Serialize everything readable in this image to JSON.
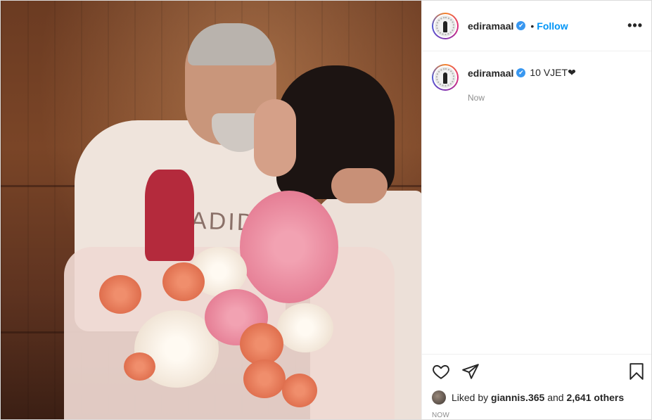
{
  "post": {
    "username": "ediramaal",
    "verified_badge": "✔",
    "separator": "•",
    "follow_label": "Follow",
    "more_icon": "more-options-icon",
    "more_glyph": "•••",
    "image_text": "ADIDAS"
  },
  "caption": {
    "username": "ediramaal",
    "text": "10 VJET❤",
    "time": "Now"
  },
  "actions": {
    "like_icon": "heart-icon",
    "share_icon": "paper-plane-icon",
    "save_icon": "bookmark-icon"
  },
  "likes": {
    "prefix": "Liked by",
    "user": "giannis.365",
    "middle": "and",
    "others": "2,641 others"
  },
  "post_date": "NOW",
  "colors": {
    "link_blue": "#0095f6",
    "verified_blue": "#3897f0",
    "muted_gray": "#8e8e8e"
  }
}
